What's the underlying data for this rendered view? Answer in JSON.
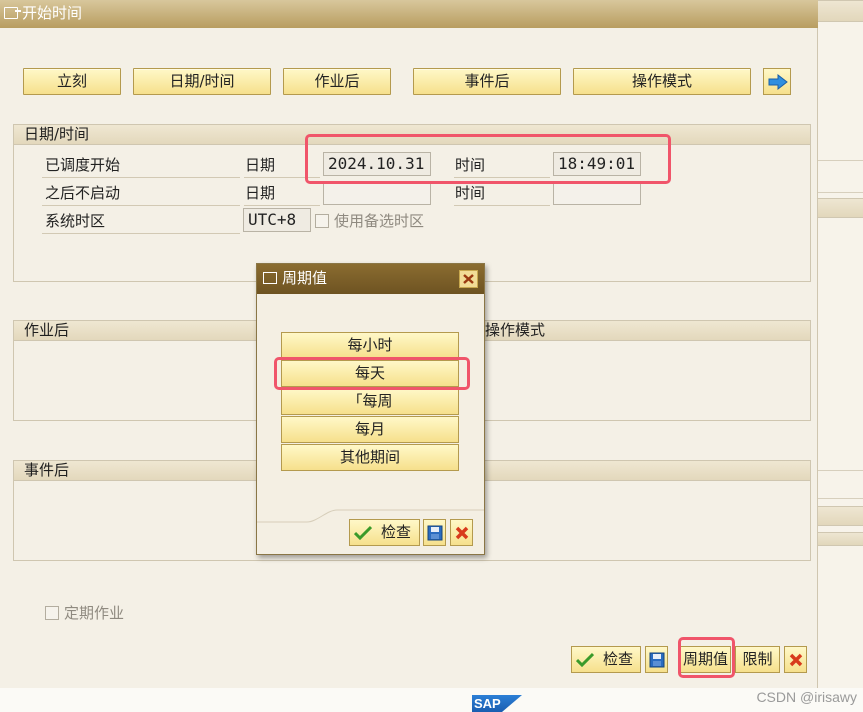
{
  "window": {
    "title": "开始时间"
  },
  "top_buttons": {
    "immediate": "立刻",
    "datetime": "日期/时间",
    "after_job": "作业后",
    "after_event": "事件后",
    "operation_mode": "操作模式"
  },
  "datetime_group": {
    "title": "日期/时间",
    "scheduled_start_label": "已调度开始",
    "no_start_after_label": "之后不启动",
    "date_label": "日期",
    "time_label": "时间",
    "scheduled_date": "2024.10.31",
    "scheduled_time": "18:49:01",
    "no_start_date": "",
    "no_start_time": "",
    "timezone_label": "系统时区",
    "timezone_value": "UTC+8",
    "alt_timezone_label": "使用备选时区"
  },
  "after_job_group": {
    "title": "作业后"
  },
  "operation_mode_group": {
    "title": "操作模式"
  },
  "after_event_group": {
    "title": "事件后"
  },
  "periodic_job_label": "定期作业",
  "bottom_toolbar": {
    "check": "检查",
    "period_values": "周期值",
    "restrictions": "限制"
  },
  "popup": {
    "title": "周期值",
    "hourly": "每小时",
    "daily": "每天",
    "weekly": "「每周",
    "monthly": "每月",
    "other_period": "其他期间",
    "check": "检查"
  },
  "footer": {
    "logo": "SAP",
    "watermark": "CSDN @irisawy"
  },
  "colors": {
    "highlight": "#f0556a",
    "button": "#f6e08c",
    "titlebar": "#b89d60",
    "popup_titlebar": "#6e5322"
  }
}
